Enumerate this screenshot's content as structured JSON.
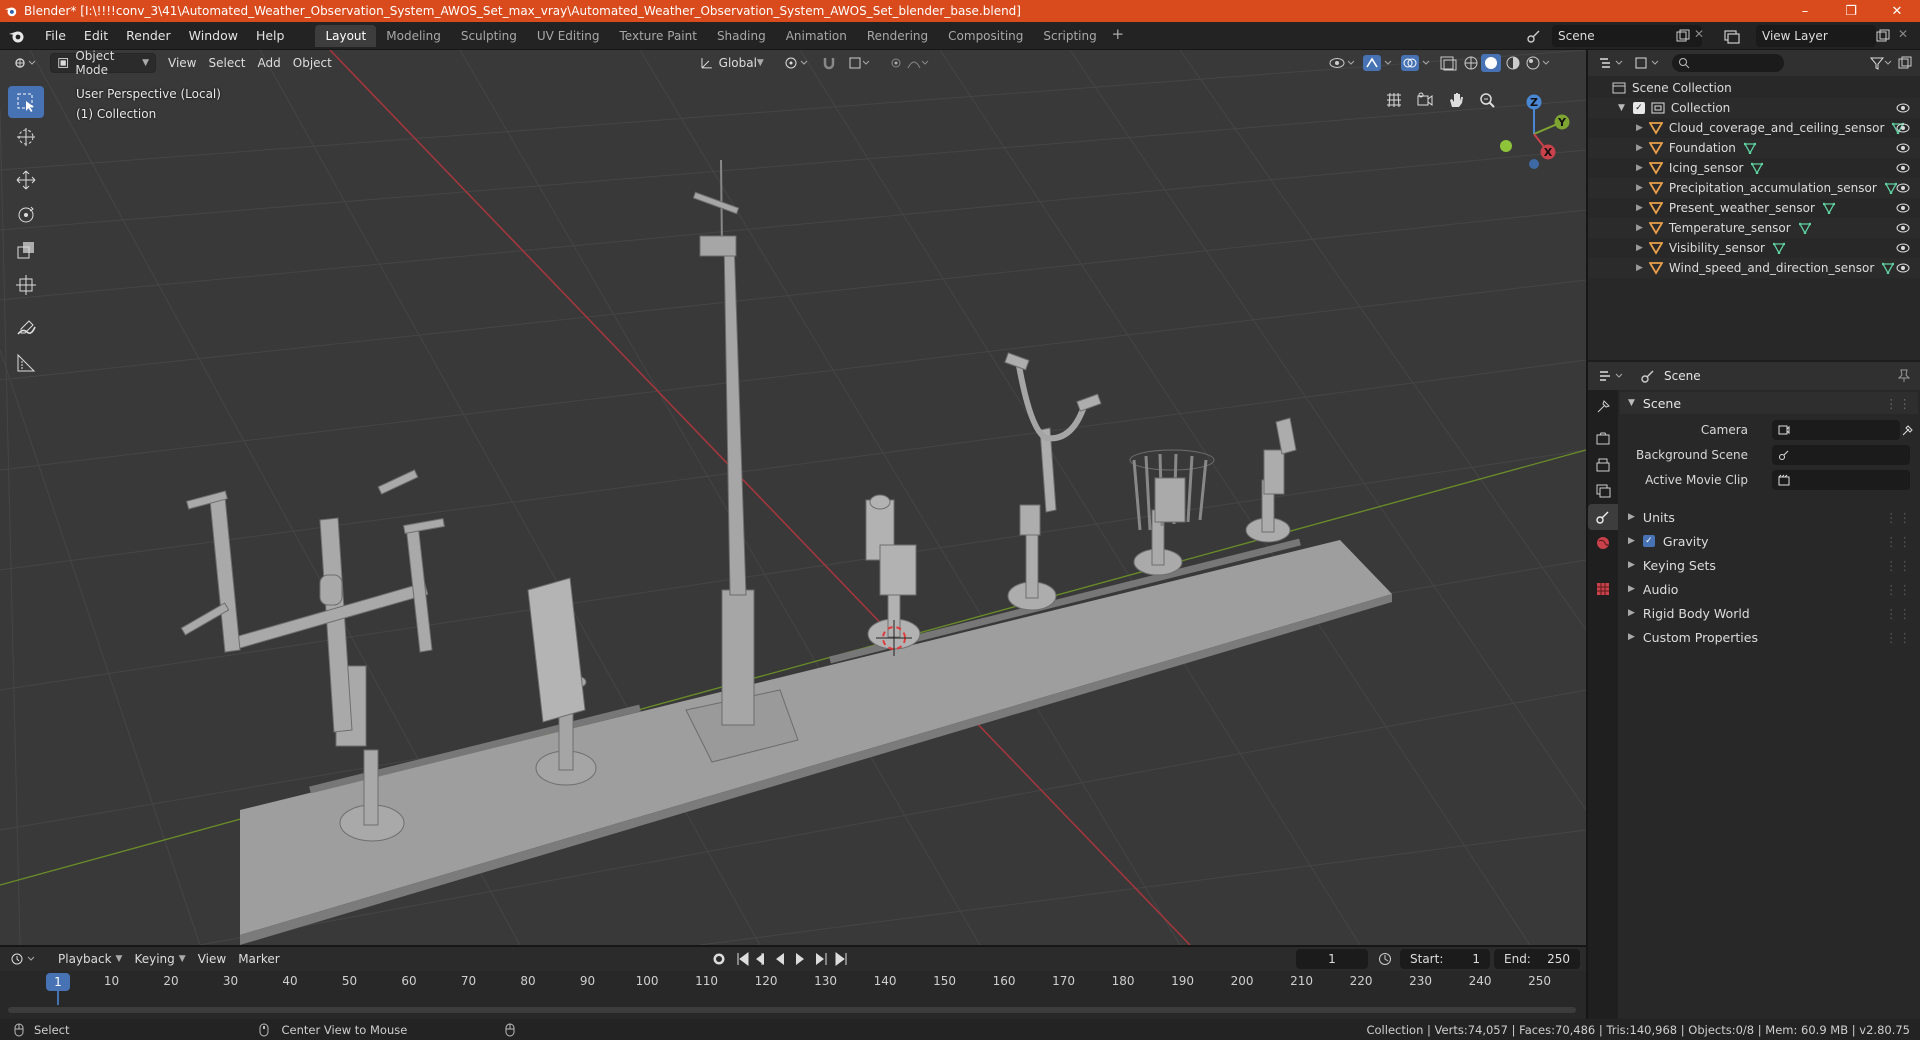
{
  "window": {
    "title": "Blender* [I:\\!!!!conv_3\\41\\Automated_Weather_Observation_System_AWOS_Set_max_vray\\Automated_Weather_Observation_System_AWOS_Set_blender_base.blend]",
    "minimize": "–",
    "maximize": "❐",
    "close": "✕"
  },
  "menu": {
    "file": "File",
    "edit": "Edit",
    "render": "Render",
    "window": "Window",
    "help": "Help"
  },
  "workspaces": [
    "Layout",
    "Modeling",
    "Sculpting",
    "UV Editing",
    "Texture Paint",
    "Shading",
    "Animation",
    "Rendering",
    "Compositing",
    "Scripting"
  ],
  "workspace_add": "+",
  "scene_selector": {
    "label": "Scene"
  },
  "view_layer_selector": {
    "label": "View Layer"
  },
  "viewport": {
    "mode": "Object Mode",
    "menus": {
      "view": "View",
      "select": "Select",
      "add": "Add",
      "object": "Object"
    },
    "transform_orientation": "Global",
    "info_line1": "User Perspective (Local)",
    "info_line2": "(1) Collection",
    "gizmo": {
      "x": "X",
      "y": "Y",
      "z": "Z"
    }
  },
  "outliner": {
    "search_placeholder": "",
    "scene_collection": "Scene Collection",
    "collection": "Collection",
    "objects": [
      "Cloud_coverage_and_ceiling_sensor",
      "Foundation",
      "Icing_sensor",
      "Precipitation_accumulation_sensor",
      "Present_weather_sensor",
      "Temperature_sensor",
      "Visibility_sensor",
      "Wind_speed_and_direction_sensor"
    ]
  },
  "properties": {
    "context": "Scene",
    "panel_title": "Scene",
    "camera_label": "Camera",
    "background_scene_label": "Background Scene",
    "active_movie_clip_label": "Active Movie Clip",
    "subpanels": [
      "Units",
      "Gravity",
      "Keying Sets",
      "Audio",
      "Rigid Body World",
      "Custom Properties"
    ],
    "gravity_checked": true
  },
  "timeline": {
    "menus": {
      "playback": "Playback",
      "keying": "Keying",
      "view": "View",
      "marker": "Marker"
    },
    "current_frame": "1",
    "start_label": "Start:",
    "start": "1",
    "end_label": "End:",
    "end": "250",
    "ruler": [
      "10",
      "20",
      "30",
      "40",
      "50",
      "60",
      "70",
      "80",
      "90",
      "100",
      "110",
      "120",
      "130",
      "140",
      "150",
      "160",
      "170",
      "180",
      "190",
      "200",
      "210",
      "220",
      "230",
      "240",
      "250"
    ],
    "playhead": "1"
  },
  "status": {
    "left_action": "Select",
    "middle_action": "Center View to Mouse",
    "stats": "Collection | Verts:74,057 | Faces:70,486 | Tris:140,968 | Objects:0/8 | Mem: 60.9 MB | v2.80.75"
  },
  "colors": {
    "title_bar": "#d94a1c",
    "accent": "#4772b3",
    "object_icon": "#e8a04a",
    "mesh_icon": "#5fd0a0",
    "x_axis": "#c8414b",
    "y_axis": "#7ea532",
    "z_axis": "#4a88d6"
  }
}
